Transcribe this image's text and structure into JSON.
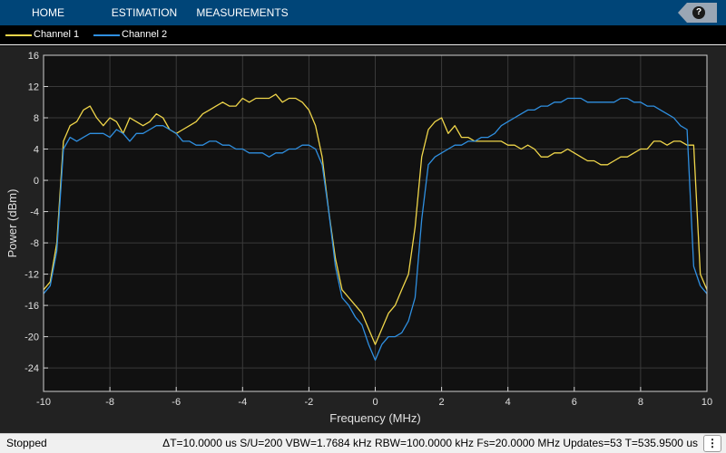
{
  "toolstrip": {
    "tabs": [
      "HOME",
      "ESTIMATION",
      "MEASUREMENTS"
    ],
    "help_label": "?"
  },
  "legend": {
    "entries": [
      {
        "name": "Channel 1",
        "color": "#f0d64a"
      },
      {
        "name": "Channel 2",
        "color": "#2f8fe0"
      }
    ]
  },
  "status": {
    "state": "Stopped",
    "info": "ΔT=10.0000 us  S/U=200  VBW=1.7684 kHz  RBW=100.0000 kHz  Fs=20.0000 MHz  Updates=53  T=535.9500 us",
    "menu_icon": "⋮"
  },
  "chart_data": {
    "type": "line",
    "xlabel": "Frequency (MHz)",
    "ylabel": "Power (dBm)",
    "xlim": [
      -10,
      10
    ],
    "ylim": [
      -27,
      16
    ],
    "xticks": [
      -10,
      -8,
      -6,
      -4,
      -2,
      0,
      2,
      4,
      6,
      8,
      10
    ],
    "yticks": [
      16,
      12,
      8,
      4,
      0,
      -4,
      -8,
      -12,
      -16,
      -20,
      -24
    ],
    "grid": true,
    "background": "#111111",
    "series": [
      {
        "name": "Channel 1",
        "color": "#f0d64a",
        "x": [
          -10,
          -9.8,
          -9.6,
          -9.4,
          -9.2,
          -9,
          -8.8,
          -8.6,
          -8.4,
          -8.2,
          -8,
          -7.8,
          -7.6,
          -7.4,
          -7.2,
          -7,
          -6.8,
          -6.6,
          -6.4,
          -6.2,
          -6,
          -5.8,
          -5.6,
          -5.4,
          -5.2,
          -5,
          -4.8,
          -4.6,
          -4.4,
          -4.2,
          -4,
          -3.8,
          -3.6,
          -3.4,
          -3.2,
          -3,
          -2.8,
          -2.6,
          -2.4,
          -2.2,
          -2,
          -1.8,
          -1.6,
          -1.4,
          -1.2,
          -1,
          -0.8,
          -0.6,
          -0.4,
          -0.2,
          0,
          0.2,
          0.4,
          0.6,
          0.8,
          1,
          1.2,
          1.4,
          1.6,
          1.8,
          2,
          2.2,
          2.4,
          2.6,
          2.8,
          3,
          3.2,
          3.4,
          3.6,
          3.8,
          4,
          4.2,
          4.4,
          4.6,
          4.8,
          5,
          5.2,
          5.4,
          5.6,
          5.8,
          6,
          6.2,
          6.4,
          6.6,
          6.8,
          7,
          7.2,
          7.4,
          7.6,
          7.8,
          8,
          8.2,
          8.4,
          8.6,
          8.8,
          9,
          9.2,
          9.4,
          9.6,
          9.8,
          10
        ],
        "values": [
          -14,
          -13,
          -8,
          5,
          7,
          7.5,
          9,
          9.5,
          8,
          7,
          8,
          7.5,
          6,
          8,
          7.5,
          7,
          7.5,
          8.5,
          8,
          6.5,
          6,
          6.5,
          7,
          7.5,
          8.5,
          9,
          9.5,
          10,
          9.5,
          9.5,
          10.5,
          10,
          10.5,
          10.5,
          10.5,
          11,
          10,
          10.5,
          10.5,
          10,
          9,
          7,
          3,
          -4,
          -10,
          -14,
          -15,
          -16,
          -17,
          -19,
          -21,
          -19,
          -17,
          -16,
          -14,
          -12,
          -6,
          3,
          6.5,
          7.5,
          8,
          6,
          7,
          5.5,
          5.5,
          5,
          5,
          5,
          5,
          5,
          4.5,
          4.5,
          4,
          4.5,
          4,
          3,
          3,
          3.5,
          3.5,
          4,
          3.5,
          3,
          2.5,
          2.5,
          2,
          2,
          2.5,
          3,
          3,
          3.5,
          4,
          4,
          5,
          5,
          4.5,
          5,
          5,
          4.5,
          4.5,
          -12,
          -14
        ]
      },
      {
        "name": "Channel 2",
        "color": "#2f8fe0",
        "x": [
          -10,
          -9.8,
          -9.6,
          -9.4,
          -9.2,
          -9,
          -8.8,
          -8.6,
          -8.4,
          -8.2,
          -8,
          -7.8,
          -7.6,
          -7.4,
          -7.2,
          -7,
          -6.8,
          -6.6,
          -6.4,
          -6.2,
          -6,
          -5.8,
          -5.6,
          -5.4,
          -5.2,
          -5,
          -4.8,
          -4.6,
          -4.4,
          -4.2,
          -4,
          -3.8,
          -3.6,
          -3.4,
          -3.2,
          -3,
          -2.8,
          -2.6,
          -2.4,
          -2.2,
          -2,
          -1.8,
          -1.6,
          -1.4,
          -1.2,
          -1,
          -0.8,
          -0.6,
          -0.4,
          -0.2,
          0,
          0.2,
          0.4,
          0.6,
          0.8,
          1,
          1.2,
          1.4,
          1.6,
          1.8,
          2,
          2.2,
          2.4,
          2.6,
          2.8,
          3,
          3.2,
          3.4,
          3.6,
          3.8,
          4,
          4.2,
          4.4,
          4.6,
          4.8,
          5,
          5.2,
          5.4,
          5.6,
          5.8,
          6,
          6.2,
          6.4,
          6.6,
          6.8,
          7,
          7.2,
          7.4,
          7.6,
          7.8,
          8,
          8.2,
          8.4,
          8.6,
          8.8,
          9,
          9.2,
          9.4,
          9.6,
          9.8,
          10
        ],
        "values": [
          -14.5,
          -13.5,
          -9,
          4,
          5.5,
          5,
          5.5,
          6,
          6,
          6,
          5.5,
          6.5,
          6,
          5,
          6,
          6,
          6.5,
          7,
          7,
          6.5,
          6,
          5,
          5,
          4.5,
          4.5,
          5,
          5,
          4.5,
          4.5,
          4,
          4,
          3.5,
          3.5,
          3.5,
          3,
          3.5,
          3.5,
          4,
          4,
          4.5,
          4.5,
          4,
          2,
          -4,
          -11,
          -15,
          -16,
          -17.5,
          -18.5,
          -21,
          -23,
          -21,
          -20,
          -20,
          -19.5,
          -18,
          -15,
          -5,
          2,
          3,
          3.5,
          4,
          4.5,
          4.5,
          5,
          5,
          5.5,
          5.5,
          6,
          7,
          7.5,
          8,
          8.5,
          9,
          9,
          9.5,
          9.5,
          10,
          10,
          10.5,
          10.5,
          10.5,
          10,
          10,
          10,
          10,
          10,
          10.5,
          10.5,
          10,
          10,
          9.5,
          9.5,
          9,
          8.5,
          8,
          7,
          6.5,
          -11,
          -13.5,
          -14.5
        ]
      }
    ]
  }
}
